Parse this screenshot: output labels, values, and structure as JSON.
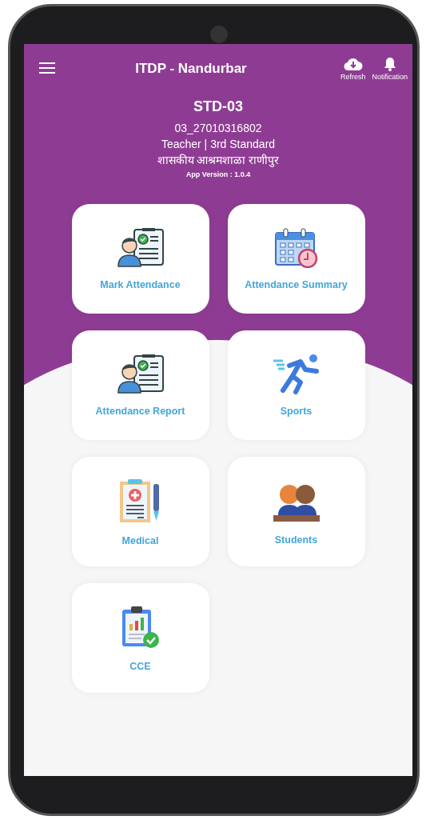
{
  "app_bar": {
    "title": "ITDP - Nandurbar",
    "actions": [
      {
        "kind": "refresh",
        "label": "Refresh"
      },
      {
        "kind": "notification",
        "label": "Notification"
      }
    ]
  },
  "profile": {
    "code": "STD-03",
    "id": "03_27010316802",
    "role": "Teacher | 3rd Standard",
    "school": "शासकीय आश्रमशाळा राणीपुर",
    "version": "App Version : 1.0.4"
  },
  "tiles": [
    {
      "kind": "attendance",
      "label": "Mark Attendance"
    },
    {
      "kind": "calendar",
      "label": "Attendance Summary"
    },
    {
      "kind": "attendance",
      "label": "Attendance Report"
    },
    {
      "kind": "sports",
      "label": "Sports"
    },
    {
      "kind": "medical",
      "label": "Medical"
    },
    {
      "kind": "students",
      "label": "Students"
    },
    {
      "kind": "report",
      "label": "CCE"
    }
  ]
}
